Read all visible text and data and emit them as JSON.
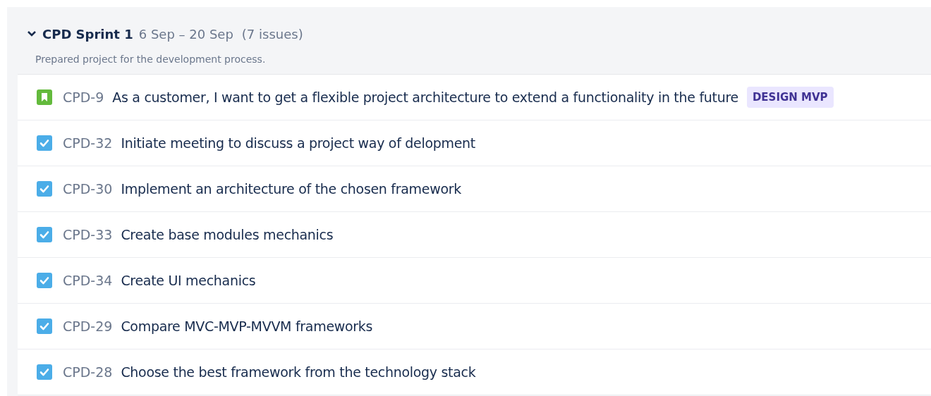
{
  "sprint": {
    "name": "CPD Sprint 1",
    "dates": "6 Sep – 20 Sep",
    "count": "(7 issues)",
    "expanded": true,
    "description": "Prepared project for the development process."
  },
  "issues": [
    {
      "kind": "story",
      "key": "CPD-9",
      "summary": "As a customer, I want to get a flexible project architecture to extend a functionality in the future",
      "epic": "DESIGN MVP"
    },
    {
      "kind": "task",
      "key": "CPD-32",
      "summary": "Initiate meeting to discuss a project way of delopment"
    },
    {
      "kind": "task",
      "key": "CPD-30",
      "summary": "Implement an architecture of the chosen framework"
    },
    {
      "kind": "task",
      "key": "CPD-33",
      "summary": "Create base modules mechanics"
    },
    {
      "kind": "task",
      "key": "CPD-34",
      "summary": "Create UI mechanics"
    },
    {
      "kind": "task",
      "key": "CPD-29",
      "summary": "Compare MVC-MVP-MVVM frameworks"
    },
    {
      "kind": "task",
      "key": "CPD-28",
      "summary": "Choose the best framework from the technology stack"
    }
  ]
}
